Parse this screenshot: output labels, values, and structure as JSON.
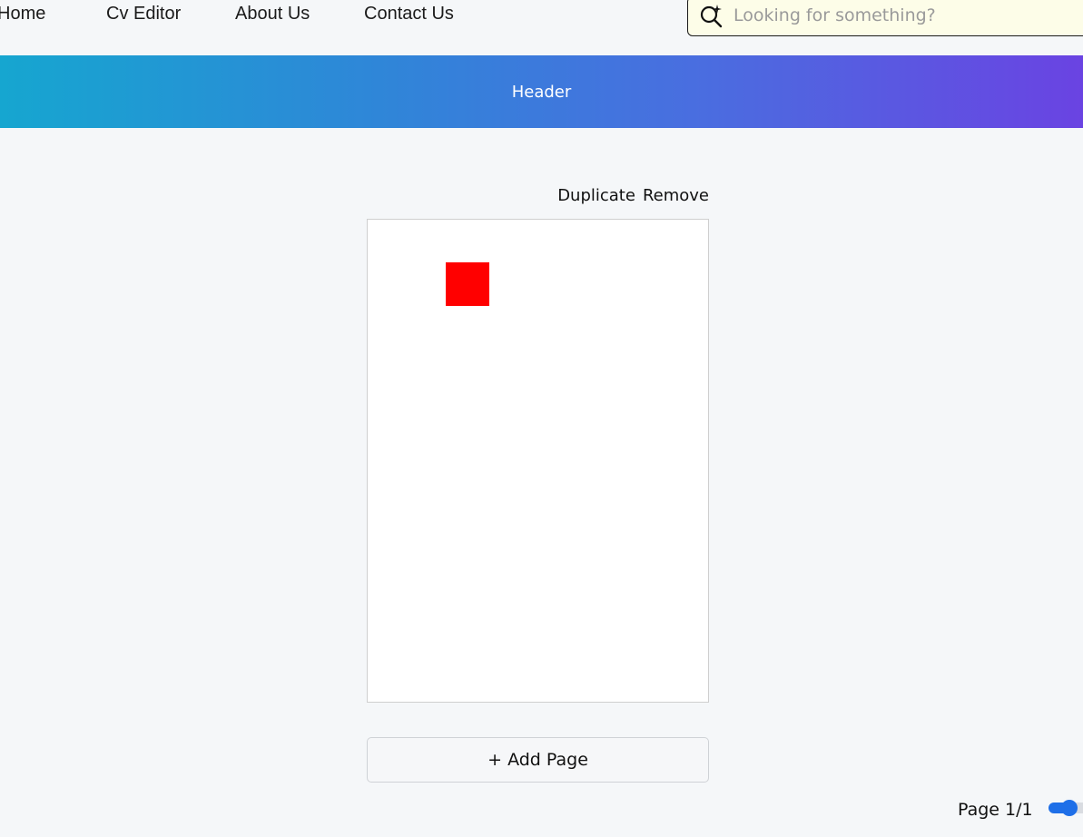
{
  "nav": {
    "items": [
      {
        "label": "Home"
      },
      {
        "label": "Cv Editor"
      },
      {
        "label": "About Us"
      },
      {
        "label": "Contact Us"
      }
    ]
  },
  "search": {
    "placeholder": "Looking for something?",
    "value": "",
    "icon": "sparkle-search-icon"
  },
  "header": {
    "title": "Header",
    "gradient": [
      "#16a6d0",
      "#6a43e2"
    ]
  },
  "page_actions": {
    "duplicate_label": "Duplicate",
    "remove_label": "Remove"
  },
  "canvas": {
    "element_color": "#ff0000"
  },
  "add_page": {
    "label": "+ Add Page"
  },
  "footer": {
    "page_indicator": "Page 1/1",
    "toggle_on": true,
    "toggle_color": "#1e6fe8"
  }
}
